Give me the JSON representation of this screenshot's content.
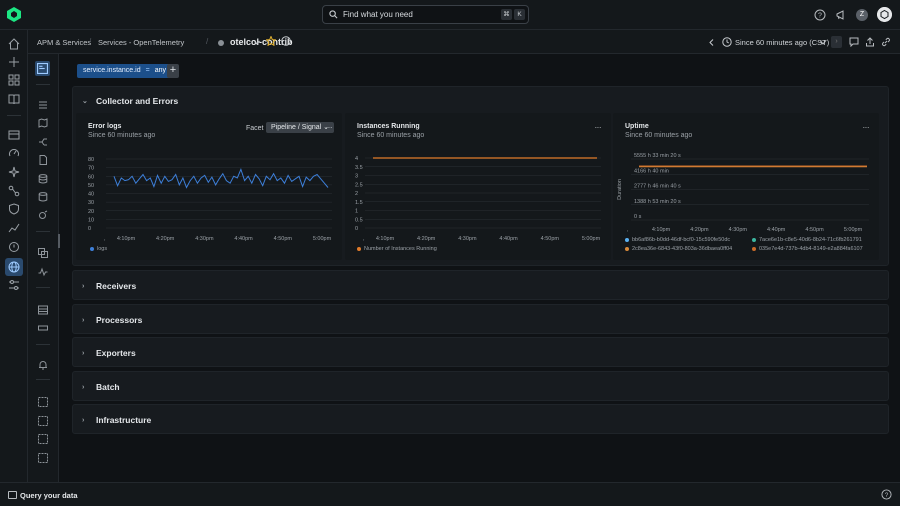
{
  "search": {
    "placeholder": "Find what you need",
    "kbd1": "⌘",
    "kbd2": "K"
  },
  "user": {
    "initial": "Z"
  },
  "breadcrumb": {
    "item1": "APM & Services",
    "item2": "Services - OpenTelemetry",
    "entity": "otelcol-contrib"
  },
  "time_picker": {
    "label": "Since 60 minutes ago (CST)"
  },
  "filter": {
    "key": "service.instance.id",
    "op": "=",
    "value": "any"
  },
  "sections": [
    {
      "title": "Collector and Errors",
      "expanded": true
    },
    {
      "title": "Receivers",
      "expanded": false
    },
    {
      "title": "Processors",
      "expanded": false
    },
    {
      "title": "Exporters",
      "expanded": false
    },
    {
      "title": "Batch",
      "expanded": false
    },
    {
      "title": "Infrastructure",
      "expanded": false
    }
  ],
  "cards": {
    "error_logs": {
      "title": "Error logs",
      "subtitle": "Since 60 minutes ago",
      "facet_label": "Facet",
      "facet_value": "Pipeline / Signal"
    },
    "instances": {
      "title": "Instances Running",
      "subtitle": "Since 60 minutes ago"
    },
    "uptime": {
      "title": "Uptime",
      "subtitle": "Since 60 minutes ago"
    }
  },
  "bottom": {
    "query_label": "Query your data"
  },
  "chart_data": [
    {
      "type": "line",
      "title": "Error logs",
      "x": [
        "4:05pm",
        "4:06pm",
        "4:07pm",
        "4:08pm",
        "4:09pm",
        "4:10pm",
        "4:11pm",
        "4:12pm",
        "4:13pm",
        "4:14pm",
        "4:15pm",
        "4:16pm",
        "4:17pm",
        "4:18pm",
        "4:19pm",
        "4:20pm",
        "4:21pm",
        "4:22pm",
        "4:23pm",
        "4:24pm",
        "4:25pm",
        "4:26pm",
        "4:27pm",
        "4:28pm",
        "4:29pm",
        "4:30pm",
        "4:31pm",
        "4:32pm",
        "4:33pm",
        "4:34pm",
        "4:35pm",
        "4:36pm",
        "4:37pm",
        "4:38pm",
        "4:39pm",
        "4:40pm",
        "4:41pm",
        "4:42pm",
        "4:43pm",
        "4:44pm",
        "4:45pm",
        "4:46pm",
        "4:47pm",
        "4:48pm",
        "4:49pm",
        "4:50pm",
        "4:51pm",
        "4:52pm",
        "4:53pm",
        "4:54pm",
        "4:55pm",
        "4:56pm",
        "4:57pm",
        "4:58pm",
        "4:59pm",
        "5:00pm",
        "5:01pm",
        "5:02pm",
        "5:03pm",
        "5:04pm"
      ],
      "x_ticks": [
        "4:10pm",
        "4:20pm",
        "4:30pm",
        "4:40pm",
        "4:50pm",
        "5:00pm"
      ],
      "series": [
        {
          "name": "logs",
          "color": "#3d7fd9",
          "values": [
            60,
            49,
            58,
            55,
            56,
            60,
            52,
            57,
            62,
            55,
            58,
            48,
            61,
            52,
            60,
            54,
            56,
            62,
            50,
            58,
            47,
            55,
            60,
            52,
            58,
            61,
            53,
            59,
            50,
            57,
            63,
            55,
            52,
            60,
            58,
            68,
            55,
            60,
            52,
            62,
            57,
            49,
            60,
            56,
            63,
            55,
            58,
            52,
            61,
            54,
            57,
            60,
            48,
            59,
            55,
            60,
            62,
            57,
            52,
            47
          ]
        }
      ],
      "y_ticks": [
        0,
        10,
        20,
        30,
        40,
        50,
        60,
        70,
        80
      ],
      "ylim": [
        0,
        80
      ]
    },
    {
      "type": "line",
      "title": "Instances Running",
      "x_ticks": [
        "4:10pm",
        "4:20pm",
        "4:30pm",
        "4:40pm",
        "4:50pm",
        "5:00pm"
      ],
      "series": [
        {
          "name": "Number of Instances Running",
          "color": "#e07b2a",
          "values": [
            4,
            4,
            4,
            4,
            4,
            4,
            4,
            4,
            4,
            4,
            4,
            4
          ]
        }
      ],
      "y_ticks": [
        "0",
        "0.5",
        "1",
        "1.5",
        "2",
        "2.5",
        "3",
        "3.5",
        "4"
      ],
      "ylim": [
        0,
        4
      ]
    },
    {
      "type": "line",
      "title": "Uptime",
      "ylabel": "Duration",
      "x_ticks": [
        "4:10pm",
        "4:20pm",
        "4:30pm",
        "4:40pm",
        "4:50pm",
        "5:00pm"
      ],
      "y_ticks": [
        "0 s",
        "1388 h 53 min 20 s",
        "2777 h 46 min 40 s",
        "4166 h 40 min",
        "5555 h 33 min 20 s"
      ],
      "series": [
        {
          "name": "bb6af86b-b0dd-46df-bcf0-15c590fe50dc",
          "color": "#5ab0f0"
        },
        {
          "name": "7ace6e1b-c8e5-40d6-8b24-71c6fb261791",
          "color": "#3cb6a0"
        },
        {
          "name": "2c8ea36e-6843-43f0-803a-36dbaea0ff04",
          "color": "#d98a3a"
        },
        {
          "name": "035e7e4d-737b-4db4-8149-e2a884fa6107",
          "color": "#c96b2a"
        }
      ]
    }
  ]
}
